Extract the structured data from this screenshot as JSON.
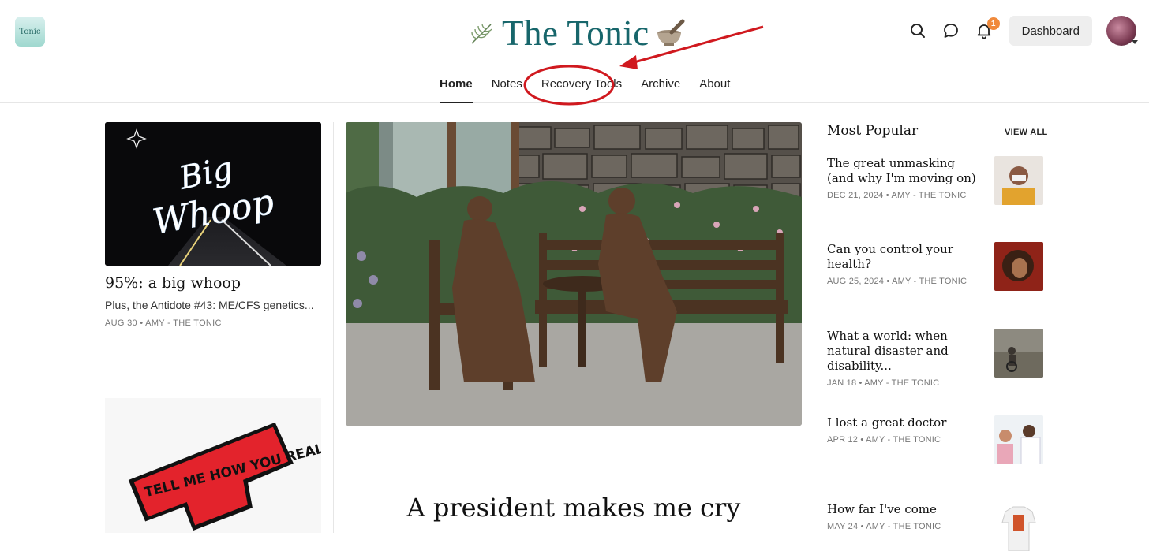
{
  "header": {
    "logo_text": "Tonic",
    "site_title": "The Tonic",
    "notification_count": "1",
    "dashboard_label": "Dashboard"
  },
  "nav": {
    "items": [
      {
        "label": "Home",
        "active": true
      },
      {
        "label": "Notes"
      },
      {
        "label": "Recovery Tools"
      },
      {
        "label": "Archive"
      },
      {
        "label": "About"
      }
    ]
  },
  "featured_left": {
    "image_text_line1": "Big",
    "image_text_line2": "Whoop",
    "title": "95%: a big whoop",
    "subtitle": "Plus, the Antidote #43: ME/CFS genetics...",
    "meta": "AUG 30 • AMY - THE TONIC",
    "second_image_text": "TELL ME HOW YOU REALLY FEEL"
  },
  "hero": {
    "title": "A president makes me cry"
  },
  "most_popular": {
    "heading": "Most Popular",
    "view_all": "VIEW ALL",
    "items": [
      {
        "title": "The great unmasking (and why I'm moving on)",
        "meta": "DEC 21, 2024 • AMY - THE TONIC"
      },
      {
        "title": "Can you control your health?",
        "meta": "AUG 25, 2024 • AMY - THE TONIC"
      },
      {
        "title": "What a world: when natural disaster and disability...",
        "meta": "JAN 18 • AMY - THE TONIC"
      },
      {
        "title": "I lost a great doctor",
        "meta": "APR 12 • AMY - THE TONIC"
      },
      {
        "title": "How far I've come",
        "meta": "MAY 24 • AMY - THE TONIC"
      }
    ]
  },
  "icons": {
    "search": "search-icon",
    "chat": "chat-bubble-icon",
    "bell": "bell-icon"
  },
  "colors": {
    "title_teal": "#17666b",
    "badge_orange": "#f08a3c",
    "annotation_red": "#d0191f"
  }
}
